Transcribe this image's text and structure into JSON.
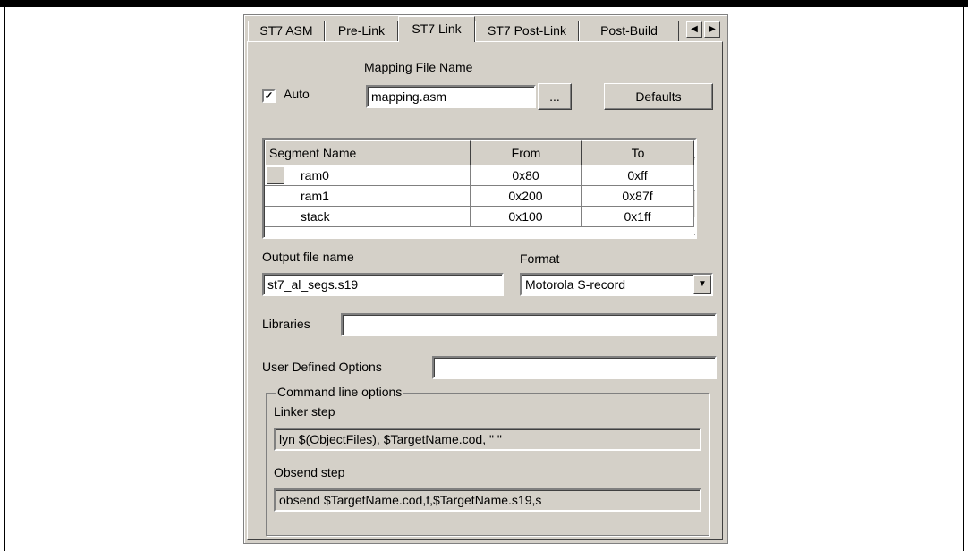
{
  "tabs": [
    {
      "label": "ST7 ASM"
    },
    {
      "label": "Pre-Link"
    },
    {
      "label": "ST7 Link",
      "active": true
    },
    {
      "label": "ST7 Post-Link"
    },
    {
      "label": "Post-Build"
    }
  ],
  "mapping": {
    "section_label": "Mapping File Name",
    "auto_label": "Auto",
    "auto_checked": true,
    "file_value": "mapping.asm",
    "browse_label": "...",
    "defaults_label": "Defaults"
  },
  "segments": {
    "columns": [
      "Segment Name",
      "From",
      "To"
    ],
    "rows": [
      {
        "name": "ram0",
        "from": "0x80",
        "to": "0xff"
      },
      {
        "name": "ram1",
        "from": "0x200",
        "to": "0x87f"
      },
      {
        "name": "stack",
        "from": "0x100",
        "to": "0x1ff"
      }
    ]
  },
  "output": {
    "label": "Output file name",
    "value": "st7_al_segs.s19"
  },
  "format": {
    "label": "Format",
    "value": "Motorola S-record"
  },
  "libraries": {
    "label": "Libraries",
    "value": ""
  },
  "user_options": {
    "label": "User Defined Options",
    "value": ""
  },
  "command_line": {
    "title": "Command line options",
    "linker_label": "Linker step",
    "linker_value": "lyn $(ObjectFiles), $TargetName.cod, \" \"",
    "obsend_label": "Obsend step",
    "obsend_value": "obsend $TargetName.cod,f,$TargetName.s19,s"
  },
  "icons": {
    "tab_left": "scroll-left-icon",
    "tab_right": "scroll-right-icon",
    "grid_up": "scroll-up-icon",
    "grid_down": "scroll-down-icon",
    "combo": "dropdown-arrow-icon",
    "check": "checkmark-icon"
  }
}
